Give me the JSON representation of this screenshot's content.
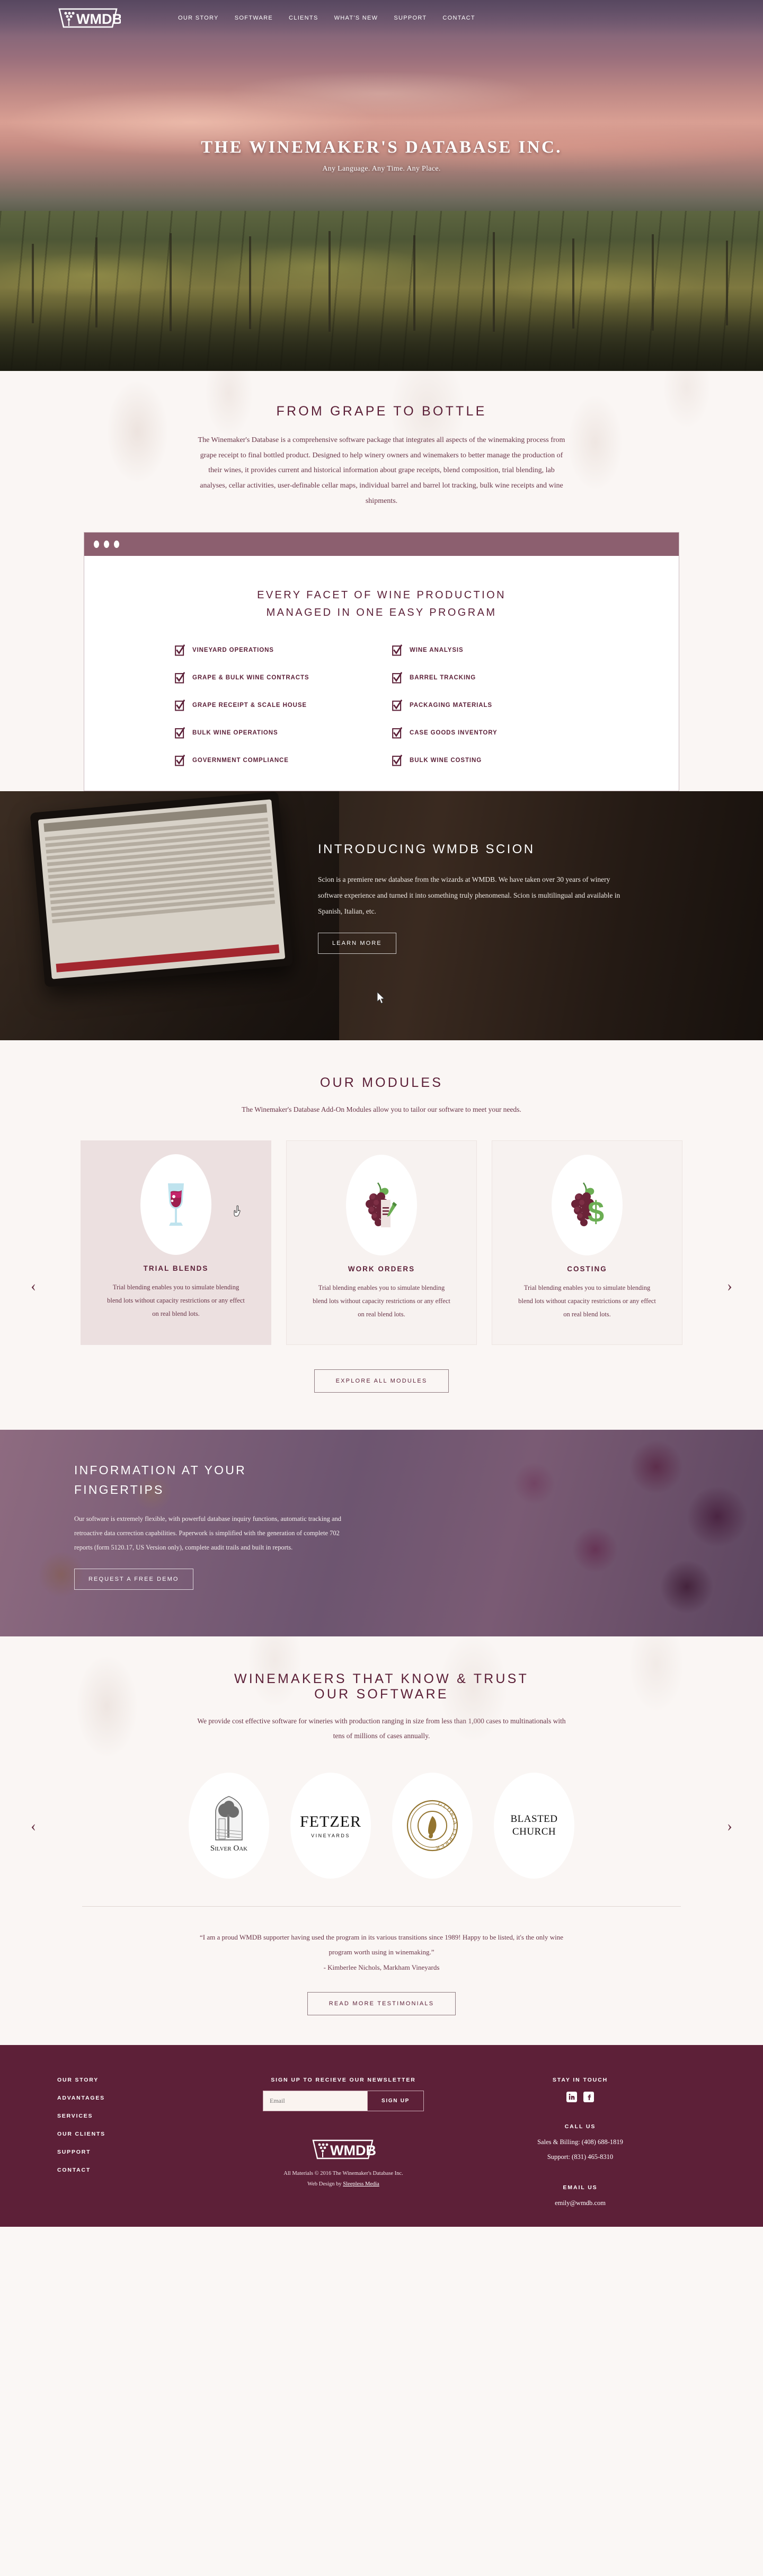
{
  "nav": {
    "logo_text": "WMDB",
    "items": [
      {
        "label": "OUR STORY"
      },
      {
        "label": "SOFTWARE"
      },
      {
        "label": "CLIENTS"
      },
      {
        "label": "WHAT'S NEW"
      },
      {
        "label": "SUPPORT"
      },
      {
        "label": "CONTACT"
      }
    ]
  },
  "hero": {
    "title": "THE WINEMAKER'S DATABASE INC.",
    "subtitle": "Any Language. Any Time. Any Place."
  },
  "grape": {
    "heading": "FROM GRAPE TO BOTTLE",
    "body": "The Winemaker's Database is a comprehensive software package that integrates all aspects of the winemaking process from grape receipt to final bottled product. Designed to help winery owners and winemakers to better manage the production of their wines, it provides current and historical information about grape receipts, blend composition, trial blending, lab analyses, cellar activities, user-definable cellar maps, individual barrel and barrel lot tracking, bulk wine receipts and wine shipments."
  },
  "browser": {
    "title_line1": "EVERY FACET OF WINE PRODUCTION",
    "title_line2": "MANAGED IN ONE EASY PROGRAM",
    "features_left": [
      "VINEYARD OPERATIONS",
      "GRAPE & BULK WINE CONTRACTS",
      "GRAPE RECEIPT & SCALE HOUSE",
      "BULK WINE OPERATIONS",
      "GOVERNMENT COMPLIANCE"
    ],
    "features_right": [
      "WINE ANALYSIS",
      "BARREL TRACKING",
      "PACKAGING MATERIALS",
      "CASE GOODS INVENTORY",
      "BULK WINE COSTING"
    ]
  },
  "scion": {
    "heading": "INTRODUCING WMDB SCION",
    "body": "Scion is a premiere new database from the wizards at WMDB.  We have taken over 30 years of winery software experience and turned it into something truly phenomenal.  Scion is multilingual and available in Spanish, Italian, etc.",
    "button": "LEARN MORE"
  },
  "modules": {
    "heading": "OUR MODULES",
    "lede": "The Winemaker's Database Add-On Modules allow you to tailor our software to meet your needs.",
    "prev_arrow": "‹",
    "next_arrow": "›",
    "cards": [
      {
        "title": "TRIAL BLENDS",
        "icon": "wine-glass-icon",
        "text": "Trial blending enables you to simulate blending blend lots without capacity restrictions or any effect on real blend lots."
      },
      {
        "title": "WORK ORDERS",
        "icon": "grapes-document-icon",
        "text": "Trial blending enables you to simulate blending blend lots without capacity restrictions or any effect on real blend lots."
      },
      {
        "title": "COSTING",
        "icon": "grapes-dollar-icon",
        "text": "Trial blending enables you to simulate blending blend lots without capacity restrictions or any effect on real blend lots."
      }
    ],
    "explore_button": "EXPLORE ALL MODULES"
  },
  "info": {
    "heading_line1": "INFORMATION AT YOUR",
    "heading_line2": "FINGERTIPS",
    "body": "Our software is extremely flexible, with powerful database inquiry functions, automatic tracking and retroactive data correction capabilities. Paperwork is simplified with the generation of complete 702 reports (form 5120.17, US Version only), complete audit trails and built in reports.",
    "button": "REQUEST A FREE DEMO"
  },
  "clients": {
    "heading_line1": "WINEMAKERS THAT KNOW & TRUST",
    "heading_line2": "OUR SOFTWARE",
    "lede": "We provide cost effective software for wineries with production ranging in size from less than 1,000 cases to multinationals with tens of millions of cases annually.",
    "prev_arrow": "‹",
    "next_arrow": "›",
    "logos": [
      {
        "name": "SILVER OAK"
      },
      {
        "name": "FETZER",
        "sub": "VINEYARDS"
      },
      {
        "name": "GLORIA FERRER"
      },
      {
        "name": "BLASTED CHURCH"
      }
    ],
    "quote": "“I am a proud WMDB supporter having used the program in its various transitions since 1989!  Happy to be listed, it's the only wine program worth using in winemaking.”",
    "quote_author": "- Kimberlee Nichols, Markham Vineyards",
    "testimonials_button": "READ MORE TESTIMONIALS"
  },
  "footer": {
    "links": [
      {
        "label": "OUR STORY"
      },
      {
        "label": "ADVANTAGES"
      },
      {
        "label": "SERVICES"
      },
      {
        "label": "OUR CLIENTS"
      },
      {
        "label": "SUPPORT"
      },
      {
        "label": "CONTACT"
      }
    ],
    "newsletter_heading": "SIGN UP TO RECIEVE OUR NEWSLETTER",
    "email_placeholder": "Email",
    "signup_button": "SIGN UP",
    "logo_text": "WMDB",
    "copyright": "All Materials © 2016 The Winemaker's Database Inc.",
    "credit_prefix": "Web Design by ",
    "credit_link": "Sleepless Media",
    "stay_in_touch": "STAY IN TOUCH",
    "social": [
      {
        "name": "linkedin-icon",
        "glyph": "in"
      },
      {
        "name": "facebook-icon",
        "glyph": "f"
      }
    ],
    "call_us": "CALL US",
    "phone_sales": "Sales & Billing: (408) 688-1819",
    "phone_support": "Support: (831) 465-8310",
    "email_us": "EMAIL US",
    "email": "emily@wmdb.com"
  },
  "colors": {
    "wine": "#5b1f37",
    "footer_bg": "#5d2038",
    "cream": "#faf6f4",
    "bar": "#8c5f6f"
  }
}
